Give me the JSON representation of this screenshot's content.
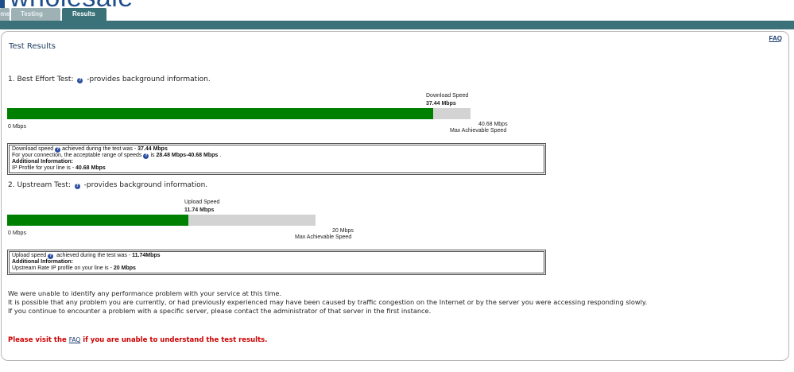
{
  "header": {
    "logo_text": "wholesale",
    "tabs": [
      {
        "label": "Home"
      },
      {
        "label": "Testing"
      },
      {
        "label": "Results"
      }
    ]
  },
  "page": {
    "faq_link": "FAQ",
    "title": "Test Results"
  },
  "download_test": {
    "heading_prefix": "1. Best Effort Test:",
    "heading_suffix": "-provides background information.",
    "speed_label": "Download Speed",
    "speed_value": "37.44 Mbps",
    "min_label": "0 Mbps",
    "max_value": "40.68 Mbps",
    "max_label": "Max Achievable Speed",
    "fill_fraction": 0.92,
    "info": {
      "line1_prefix": "Download speed",
      "line1_mid": "achieved during the test was -",
      "line1_value": "37.44 Mbps",
      "line2_prefix": "For your connection, the acceptable range of speeds",
      "line2_mid": "is",
      "line2_value": "28.48 Mbps-40.68 Mbps",
      "line2_suffix": ".",
      "additional_heading": "Additional Information:",
      "line4_prefix": "IP Profile for your line is -",
      "line4_value": "40.68 Mbps"
    }
  },
  "upload_test": {
    "heading_prefix": "2. Upstream Test:",
    "heading_suffix": "-provides background information.",
    "speed_label": "Upload Speed",
    "speed_value": "11.74 Mbps",
    "min_label": "0 Mbps",
    "max_value": "20 Mbps",
    "max_label": "Max Achievable Speed",
    "fill_fraction": 0.587,
    "info": {
      "line1_prefix": "Upload speed",
      "line1_mid": "achieved during the test was -",
      "line1_value": "11.74Mbps",
      "additional_heading": "Additional Information:",
      "line3_prefix": "Upstream Rate IP profile on your line is -",
      "line3_value": "20 Mbps"
    }
  },
  "summary": {
    "line1": "We were unable to identify any performance problem with your service at this time.",
    "line2": "It is possible that any problem you are currently, or had previously experienced may have been caused by traffic congestion on the Internet or by the server you were accessing responding slowly.",
    "line3": "If you continue to encounter a problem with a specific server, please contact the administrator of that server in the first instance."
  },
  "footer": {
    "prefix": "Please visit the",
    "link": "FAQ",
    "suffix": "if you are unable to understand the test results."
  },
  "colors": {
    "teal": "#3b7279",
    "bar_fill": "#008000",
    "bar_track": "#d3d3d3",
    "warning": "#cc0000"
  },
  "icons": [
    "help-icon"
  ]
}
